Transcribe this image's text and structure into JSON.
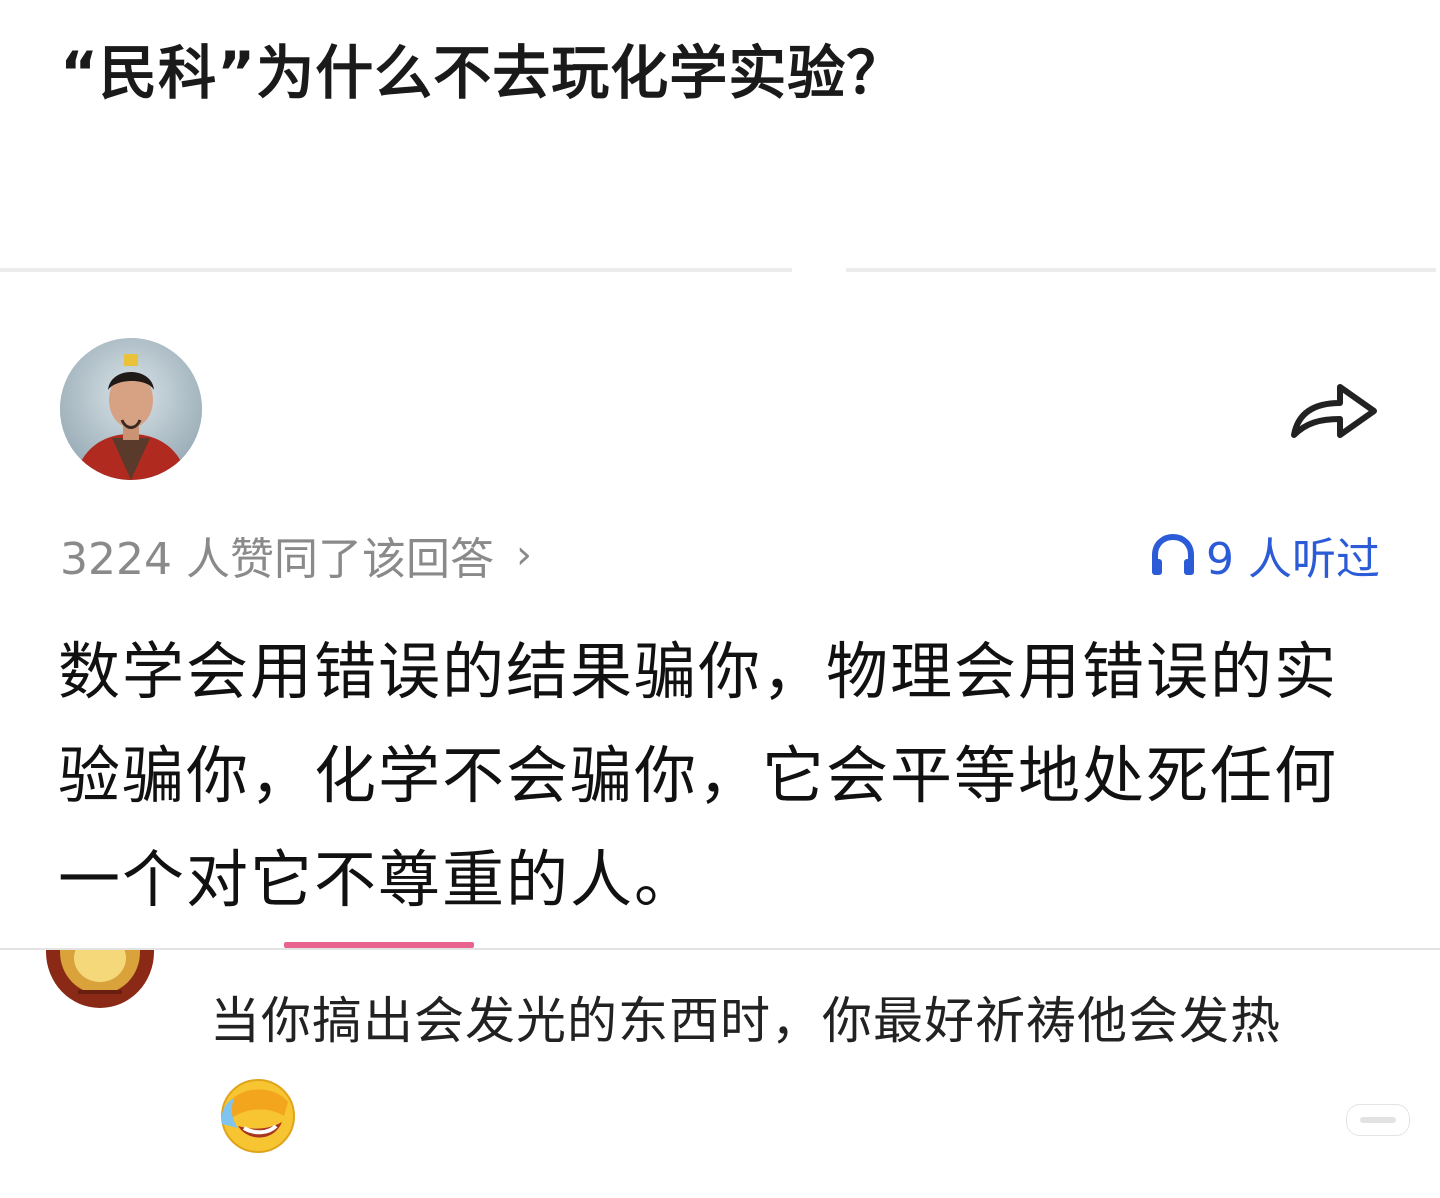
{
  "question": {
    "title": "“民科”为什么不去玩化学实验？"
  },
  "answer": {
    "author_avatar_icon": "author-avatar",
    "share_icon": "share-arrow-icon",
    "votes_text": "3224 人赞同了该回答",
    "votes_chevron": "›",
    "listen_icon": "headphones-icon",
    "listen_text": "9 人听过",
    "body": "数学会用错误的结果骗你，物理会用错误的实验骗你，化学不会骗你，它会平等地处死任何一个对它不尊重的人。"
  },
  "comment": {
    "avatar_icon": "commenter-avatar",
    "text": "当你搞出会发光的东西时，你最好祈祷他会发热",
    "emoji_icon": "laughing-crying-emoji"
  },
  "colors": {
    "accent_blue": "#2b5bd7",
    "meta_gray": "#8a8a8a",
    "pink_underline": "#e8638f"
  }
}
